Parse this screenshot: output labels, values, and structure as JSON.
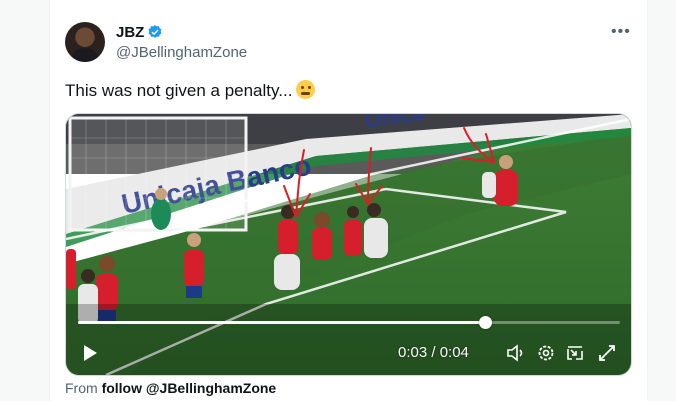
{
  "author": {
    "name": "JBZ",
    "handle": "@JBellinghamZone",
    "verified": true,
    "verified_color": "#1d9bf0"
  },
  "tweet": {
    "text": "This was not given a penalty...",
    "emoji": "zipper-mouth-face"
  },
  "video": {
    "banner_text_1": "Unicaja Banco",
    "banner_text_2": "Unica",
    "time_label": "0:03 / 0:04",
    "progress": 0.75,
    "accent_arrows": "#d91f26",
    "controls": [
      "play-icon",
      "volume-icon",
      "settings-icon",
      "pip-icon",
      "fullscreen-icon"
    ]
  },
  "footer": {
    "prefix": "From",
    "link_label": "follow @JBellinghamZone"
  }
}
